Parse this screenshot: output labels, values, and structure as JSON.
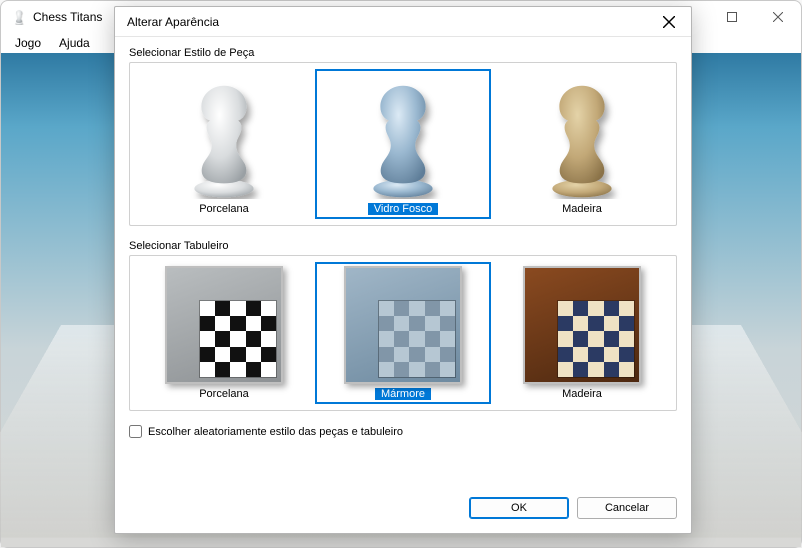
{
  "window": {
    "title": "Chess Titans",
    "menu": {
      "items": [
        "Jogo",
        "Ajuda"
      ]
    }
  },
  "dialog": {
    "title": "Alterar Aparência",
    "section_piece_label": "Selecionar Estilo de Peça",
    "section_board_label": "Selecionar Tabuleiro",
    "pieces": [
      {
        "label": "Porcelana",
        "selected": false
      },
      {
        "label": "Vidro Fosco",
        "selected": true
      },
      {
        "label": "Madeira",
        "selected": false
      }
    ],
    "boards": [
      {
        "label": "Porcelana",
        "selected": false
      },
      {
        "label": "Mármore",
        "selected": true
      },
      {
        "label": "Madeira",
        "selected": false
      }
    ],
    "random_checkbox": {
      "label": "Escolher aleatoriamente estilo das peças e tabuleiro",
      "checked": false
    },
    "buttons": {
      "ok": "OK",
      "cancel": "Cancelar"
    }
  }
}
